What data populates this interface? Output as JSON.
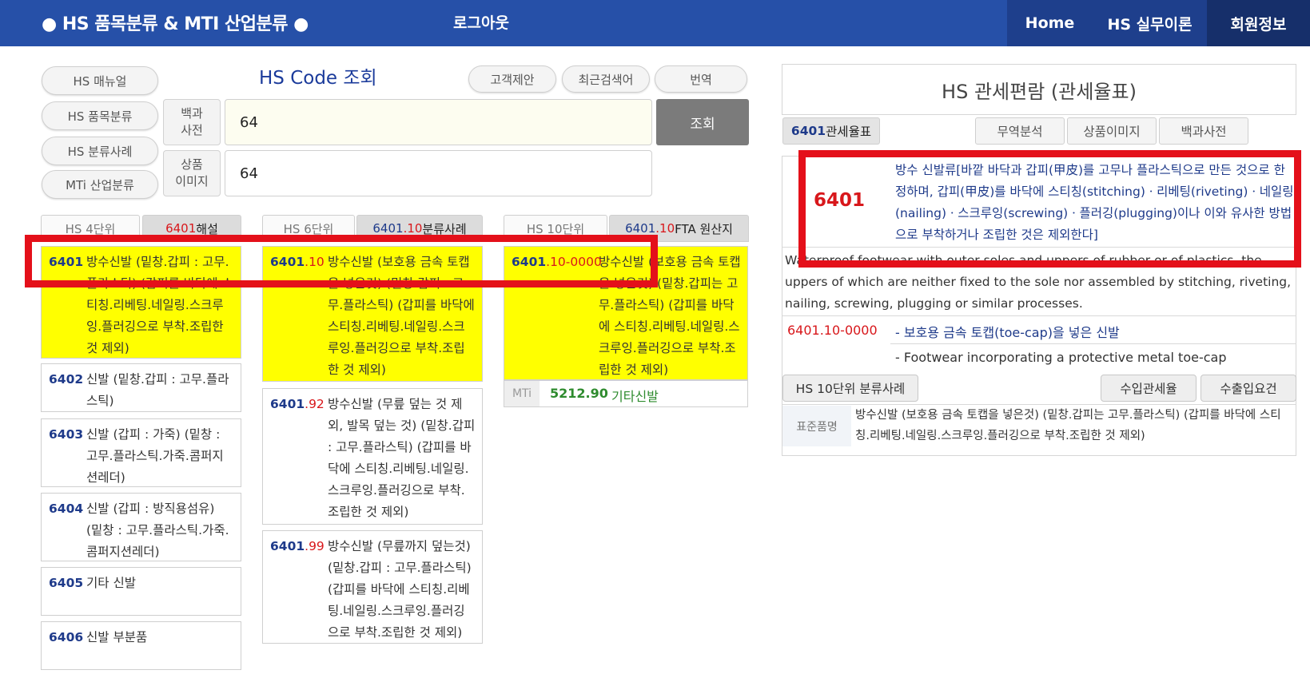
{
  "header": {
    "brand": "● HS 품목분류 & MTI 산업분류 ●",
    "logout": "로그아웃",
    "nav": [
      "Home",
      "HS 실무이론",
      "회원정보"
    ]
  },
  "left_menu": [
    "HS 매뉴얼",
    "HS 품목분류",
    "HS 분류사례",
    "MTi 산업분류"
  ],
  "search": {
    "title": "HS Code 조회",
    "top_buttons": [
      "고객제안",
      "최근검색어",
      "번역"
    ],
    "label_dictionary": "백과\n사전",
    "label_image": "상품\n이미지",
    "query_value": "64",
    "image_value": "64",
    "search_button": "조회"
  },
  "columns": {
    "col4": {
      "tab_light": "HS 4단위",
      "tab_code": "6401",
      "tab_suffix": " 해설"
    },
    "col6": {
      "tab_light": "HS 6단위",
      "tab_code_main": "6401",
      "tab_code_sub": ".10",
      "tab_suffix": " 분류사례"
    },
    "col10": {
      "tab_light": "HS 10단위",
      "tab_code_main": "6401",
      "tab_code_sub": ".10",
      "tab_suffix": " FTA 원산지"
    }
  },
  "hs4": [
    {
      "code": "6401",
      "desc": "방수신발 (밑창.갑피 : 고무.플라스틱) (갑피를 바닥에 스티칭.리베팅.네일링.스크루잉.플러깅으로 부착.조립한 것 제외)"
    },
    {
      "code": "6402",
      "desc": "신발 (밑창.갑피 : 고무.플라스틱)"
    },
    {
      "code": "6403",
      "desc": "신발 (갑피 : 가죽) (밑창 : 고무.플라스틱.가죽.콤퍼지션레더)"
    },
    {
      "code": "6404",
      "desc": "신발 (갑피 : 방직용섬유) (밑창 : 고무.플라스틱.가죽.콤퍼지션레더)"
    },
    {
      "code": "6405",
      "desc": "기타 신발"
    },
    {
      "code": "6406",
      "desc": "신발 부분품"
    }
  ],
  "hs6": [
    {
      "code_main": "6401",
      "code_sub": ".10",
      "desc": "방수신발 (보호용 금속 토캡을 넣은것) (밑창.갑피 : 고무.플라스틱) (갑피를 바닥에 스티칭.리베팅.네일링.스크루잉.플러깅으로 부착.조립한 것 제외)"
    },
    {
      "code_main": "6401",
      "code_sub": ".92",
      "desc": "방수신발 (무릎 덮는 것 제외, 발목 덮는 것) (밑창.갑피 : 고무.플라스틱) (갑피를 바닥에 스티칭.리베팅.네일링.스크루잉.플러깅으로 부착.조립한 것 제외)"
    },
    {
      "code_main": "6401",
      "code_sub": ".99",
      "desc": "방수신발 (무릎까지 덮는것) (밑창.갑피 : 고무.플라스틱) (갑피를 바닥에 스티칭.리베팅.네일링.스크루잉.플러깅으로 부착.조립한 것 제외)"
    }
  ],
  "hs10": {
    "code_main": "6401",
    "code_sub": ".10-0000",
    "desc": "방수신발 (보호용 금속 토캡을 넣은것) (밑창.갑피는 고무.플라스틱) (갑피를 바닥에 스티칭.리베팅.네일링.스크루잉.플러깅으로 부착.조립한 것 제외)",
    "mti_tag": "MTi",
    "mti_code": "5212.90",
    "mti_name": "기타신발"
  },
  "right_panel": {
    "title": "HS 관세편람 (관세율표)",
    "tab_code": "6401",
    "tab_label": " 관세율표",
    "tabs": [
      "무역분석",
      "상품이미지",
      "백과사전"
    ],
    "heading_code": "6401",
    "heading_kr": "방수 신발류[바깥 바닥과 갑피(甲皮)를 고무나 플라스틱으로 만든 것으로 한정하며, 갑피(甲皮)를 바닥에 스티칭(stitching)ㆍ리베팅(riveting)ㆍ네일링(nailing)ㆍ스크루잉(screwing)ㆍ플러깅(plugging)이나 이와 유사한 방법으로 부착하거나 조립한 것은 제외한다]",
    "heading_en": "Waterproof footwear with outer soles and uppers of rubber or of plastics, the uppers of which are neither fixed to the sole nor assembled by stitching, riveting, nailing, screwing, plugging or similar processes.",
    "sub_code": "6401.10-0000",
    "sub_kr": "- 보호용 금속 토캡(toe-cap)을 넣은 신발",
    "sub_en": "- Footwear incorporating a protective metal toe-cap",
    "btn_cases": "HS 10단위 분류사례",
    "btn_import": "수입관세율",
    "btn_export": "수출입요건",
    "std_label": "표준품명",
    "std_text": "방수신발 (보호용 금속 토캡을 넣은것) (밑창.갑피는 고무.플라스틱) (갑피를 바닥에 스티칭.리베팅.네일링.스크루잉.플러깅으로 부착.조립한 것 제외)"
  },
  "colors": {
    "header": "#2650a8",
    "highlight_red": "#e4101a",
    "selected_yellow": "#ffff00",
    "code_navy": "#1e3a8a",
    "code_red": "#d8171b",
    "mti_green": "#2e8b2e"
  }
}
